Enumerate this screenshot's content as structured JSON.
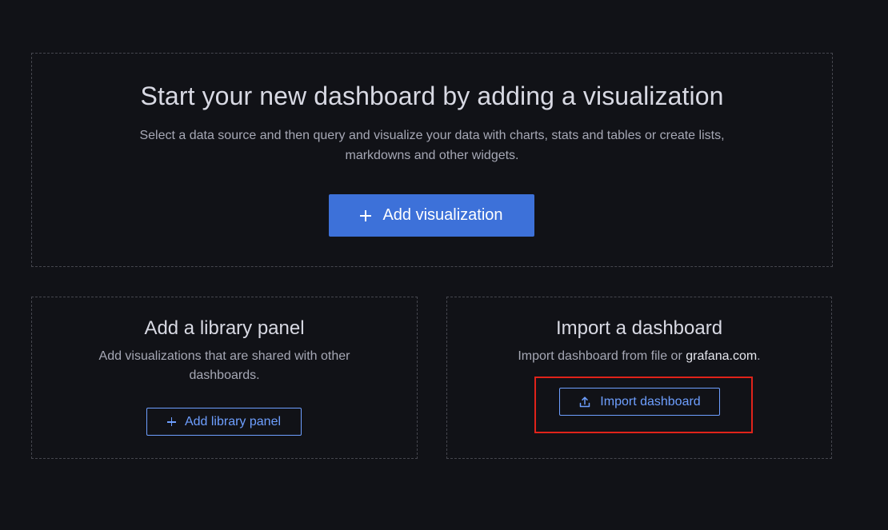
{
  "main_panel": {
    "title": "Start your new dashboard by adding a visualization",
    "description": "Select a data source and then query and visualize your data with charts, stats and tables or create lists, markdowns and other widgets.",
    "button_label": "Add visualization",
    "button_icon": "plus-icon"
  },
  "library_panel": {
    "title": "Add a library panel",
    "description": "Add visualizations that are shared with other dashboards.",
    "button_label": "Add library panel",
    "button_icon": "plus-icon"
  },
  "import_panel": {
    "title": "Import a dashboard",
    "description_prefix": "Import dashboard from file or ",
    "description_link": "grafana.com",
    "description_suffix": ".",
    "button_label": "Import dashboard",
    "button_icon": "upload-icon"
  },
  "colors": {
    "background": "#111217",
    "primary_button": "#3d71d9",
    "secondary_button_text": "#6e9fff",
    "annotation_highlight": "#e0231a"
  }
}
